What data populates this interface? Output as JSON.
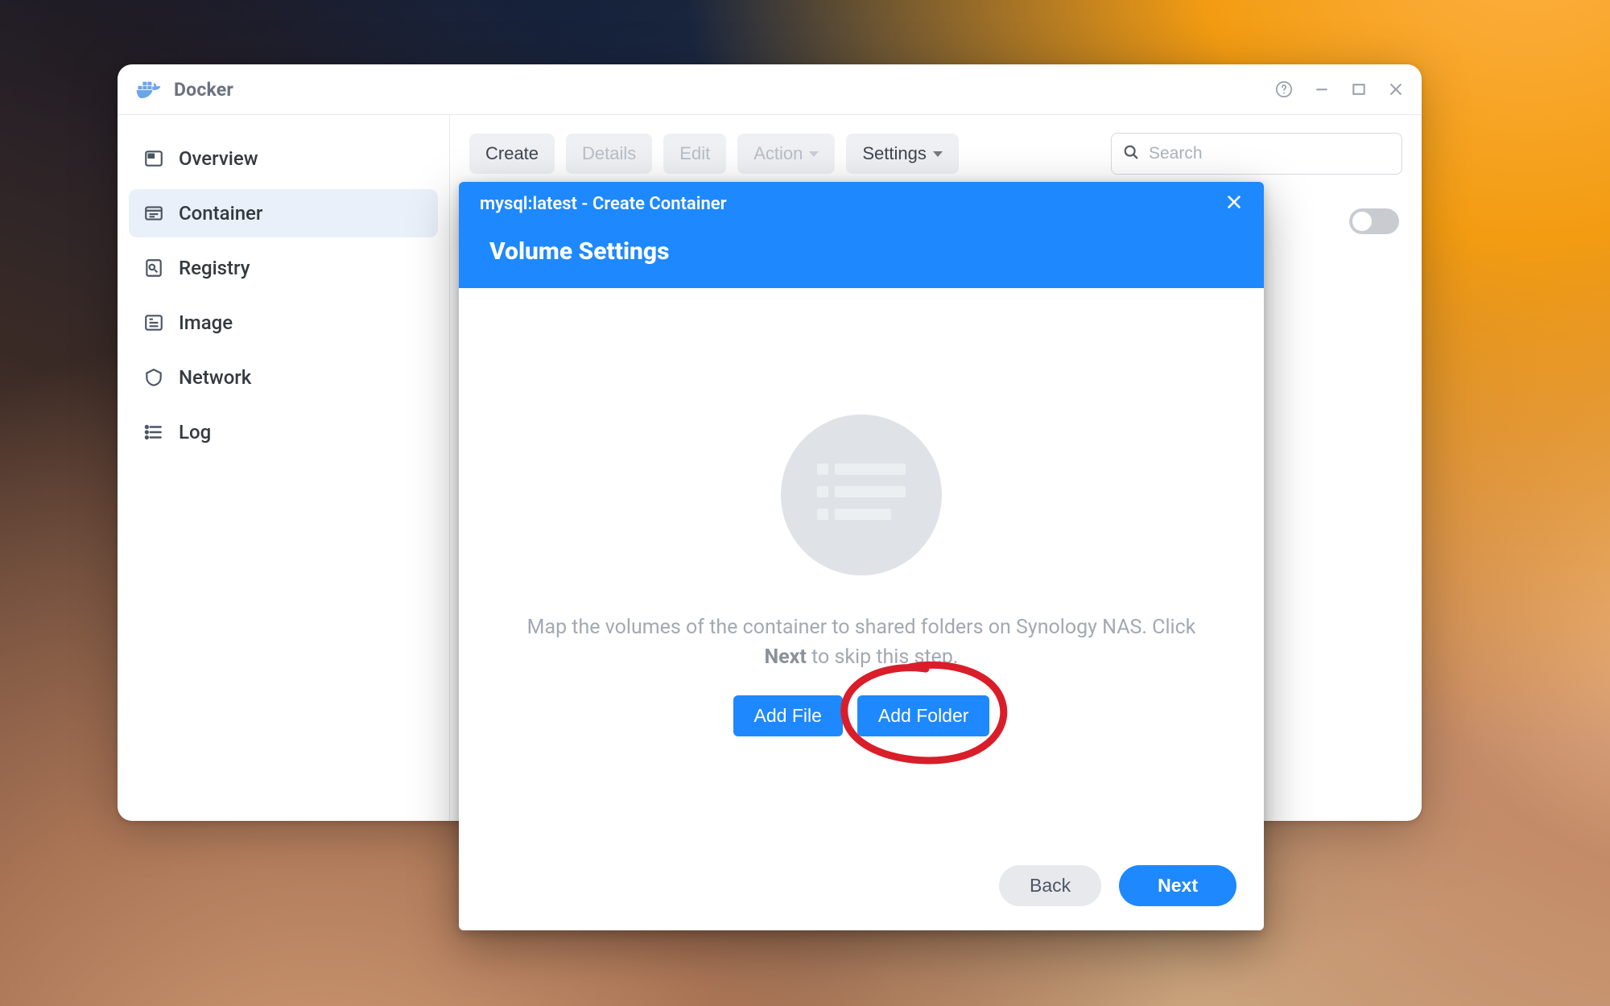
{
  "app": {
    "title": "Docker"
  },
  "sidebar": {
    "items": [
      {
        "label": "Overview"
      },
      {
        "label": "Container"
      },
      {
        "label": "Registry"
      },
      {
        "label": "Image"
      },
      {
        "label": "Network"
      },
      {
        "label": "Log"
      }
    ],
    "active_index": 1
  },
  "toolbar": {
    "create": "Create",
    "details": "Details",
    "edit": "Edit",
    "action": "Action",
    "settings": "Settings",
    "search_placeholder": "Search"
  },
  "modal": {
    "title": "mysql:latest - Create Container",
    "section": "Volume Settings",
    "empty_text_pre": "Map the volumes of the container to shared folders on Synology NAS. Click ",
    "empty_text_bold": "Next",
    "empty_text_post": " to skip this step.",
    "add_file": "Add File",
    "add_folder": "Add Folder",
    "back": "Back",
    "next": "Next"
  }
}
